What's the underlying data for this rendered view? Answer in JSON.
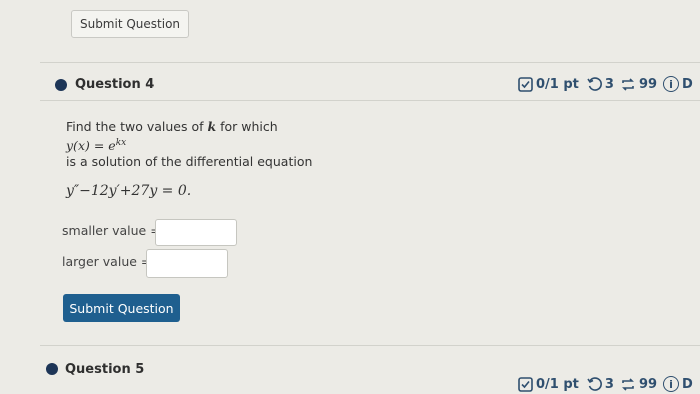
{
  "top_button": {
    "label": "Submit Question"
  },
  "question4": {
    "title": "Question 4",
    "score": "0/1 pt",
    "retries": "3",
    "attempts": "99",
    "info_letter": "D",
    "prompt_line1": "Find the two values of ",
    "prompt_var": "k",
    "prompt_line1_end": " for which",
    "function_lhs": "y(x) = e",
    "function_exp": "kx",
    "prompt_line3": "is a solution of the differential equation",
    "equation": "y″−12y′+27y = 0.",
    "smaller_label": "smaller value =",
    "smaller_value": "",
    "larger_label": "larger value =",
    "larger_value": "",
    "submit_label": "Submit Question"
  },
  "question5": {
    "title": "Question 5",
    "score": "0/1 pt",
    "retries": "3",
    "attempts": "99",
    "info_letter": "D"
  },
  "colors": {
    "accent": "#1f5f8f",
    "bullet": "#1d3557",
    "meta_text": "#2f4f6f",
    "background": "#ecebe6"
  },
  "icons": [
    "checkbox-icon",
    "retry-icon",
    "attempts-icon",
    "info-icon"
  ]
}
